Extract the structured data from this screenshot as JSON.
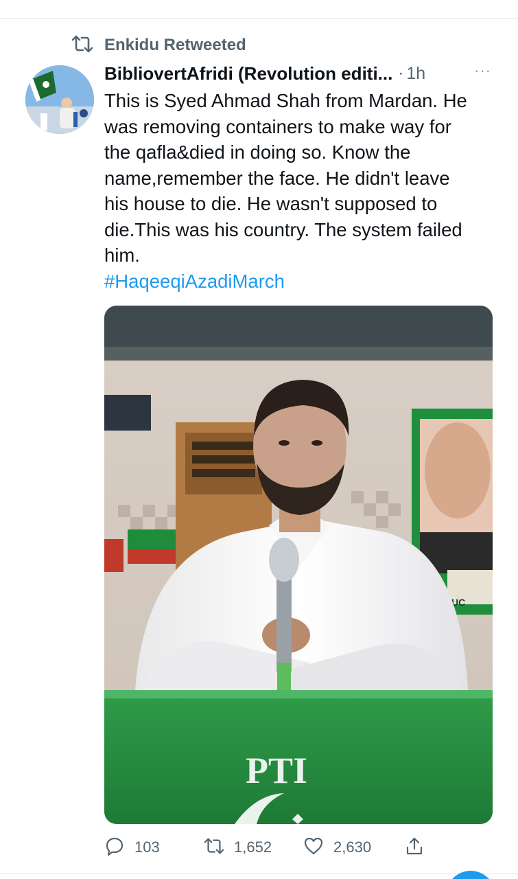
{
  "retweet": {
    "icon": "retweet-icon",
    "text": "Enkidu Retweeted"
  },
  "tweet": {
    "author_name": "BibliovertAfridi (Revolution editi...",
    "separator": "·",
    "time": "1h",
    "more": "···",
    "text_lines": [
      "This is Syed Ahmad Shah from Mardan. He",
      "was removing containers to make way for",
      "the qafla&died in doing so. Know the",
      "name,remember the face. He didn't leave",
      "his house to die. He wasn't supposed to",
      "die.This was his country. The system failed",
      "him."
    ],
    "hashtag": "#HaqeeqiAzadiMarch",
    "media": {
      "description_icon": "photo-man-speaking-icon",
      "podium_text": "PTI",
      "poster_text": "UC"
    }
  },
  "actions": {
    "reply": {
      "icon": "reply-icon",
      "count": "103"
    },
    "retweet": {
      "icon": "retweet-icon",
      "count": "1,652"
    },
    "like": {
      "icon": "heart-icon",
      "count": "2,630"
    },
    "share": {
      "icon": "share-icon"
    }
  },
  "colors": {
    "link": "#1d9bf0",
    "secondary_text": "#536471",
    "primary_text": "#0f1419"
  }
}
